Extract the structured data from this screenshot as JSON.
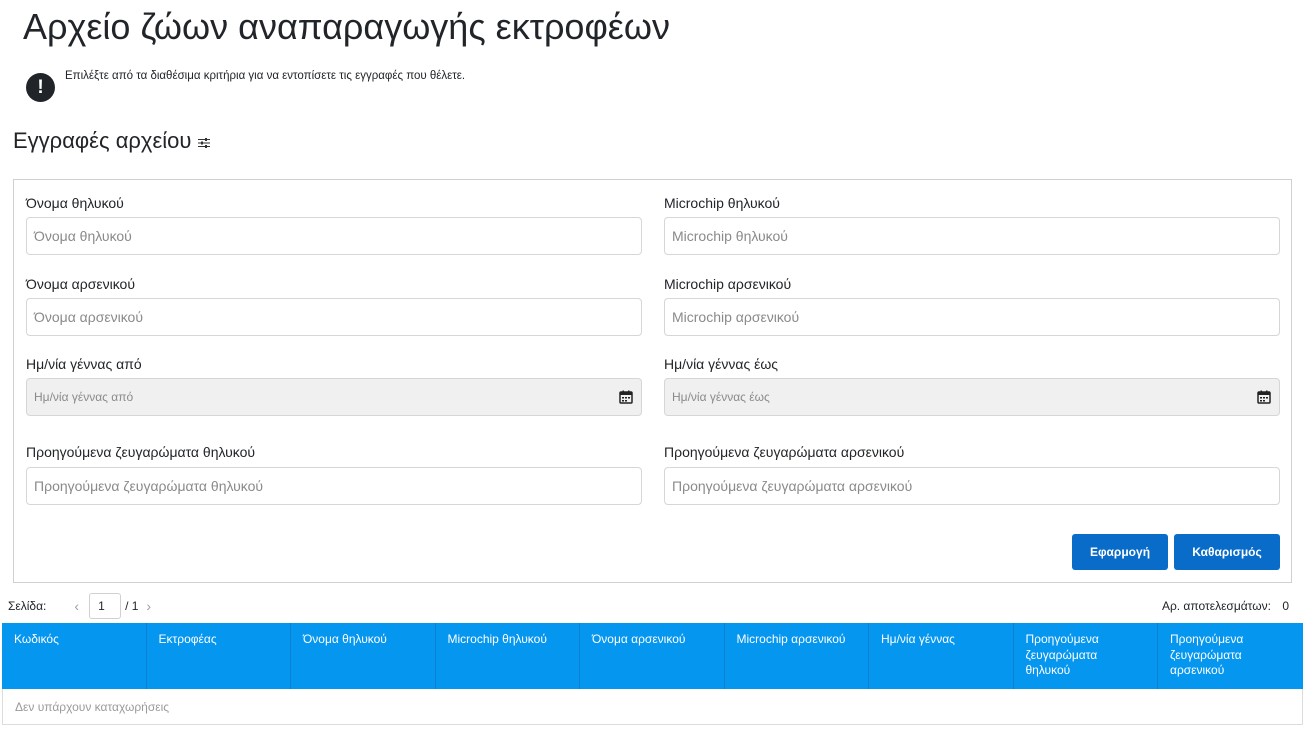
{
  "page": {
    "title": "Αρχείο ζώων αναπαραγωγής εκτροφέων",
    "info_message": "Επιλέξτε από τα διαθέσιμα κριτήρια για να εντοπίσετε τις εγγραφές που θέλετε.",
    "section_title": "Εγγραφές αρχείου"
  },
  "filters": {
    "female_name": {
      "label": "Όνομα θηλυκού",
      "placeholder": "Όνομα θηλυκού",
      "value": ""
    },
    "female_microchip": {
      "label": "Microchip θηλυκού",
      "placeholder": "Microchip θηλυκού",
      "value": ""
    },
    "male_name": {
      "label": "Όνομα αρσενικού",
      "placeholder": "Όνομα αρσενικού",
      "value": ""
    },
    "male_microchip": {
      "label": "Microchip αρσενικού",
      "placeholder": "Microchip αρσενικού",
      "value": ""
    },
    "birth_from": {
      "label": "Ημ/νία γέννας από",
      "placeholder": "Ημ/νία γέννας από",
      "value": ""
    },
    "birth_to": {
      "label": "Ημ/νία γέννας έως",
      "placeholder": "Ημ/νία γέννας έως",
      "value": ""
    },
    "female_prev_matings": {
      "label": "Προηγούμενα ζευγαρώματα θηλυκού",
      "placeholder": "Προηγούμενα ζευγαρώματα θηλυκού",
      "value": ""
    },
    "male_prev_matings": {
      "label": "Προηγούμενα ζευγαρώματα αρσενικού",
      "placeholder": "Προηγούμενα ζευγαρώματα αρσενικού",
      "value": ""
    },
    "apply_label": "Εφαρμογή",
    "clear_label": "Καθαρισμός"
  },
  "pagination": {
    "page_label": "Σελίδα:",
    "current_page": "1",
    "total_pages": "/ 1",
    "results_label": "Αρ. αποτελεσμάτων:",
    "results_count": "0"
  },
  "table": {
    "columns": [
      "Κωδικός",
      "Εκτροφέας",
      "Όνομα θηλυκού",
      "Microchip θηλυκού",
      "Όνομα αρσενικού",
      "Microchip αρσενικού",
      "Ημ/νία γέννας",
      "Προηγούμενα ζευγαρώματα θηλυκού",
      "Προηγούμενα ζευγαρώματα αρσενικού"
    ],
    "empty_message": "Δεν υπάρχουν καταχωρήσεις"
  },
  "colors": {
    "primary_button": "#0a6cc9",
    "table_header": "#0596f0"
  },
  "icons": {
    "info": "exclamation-circle-icon",
    "filter": "sliders-icon",
    "calendar": "calendar-icon",
    "prev": "chevron-left-icon",
    "next": "chevron-right-icon"
  }
}
